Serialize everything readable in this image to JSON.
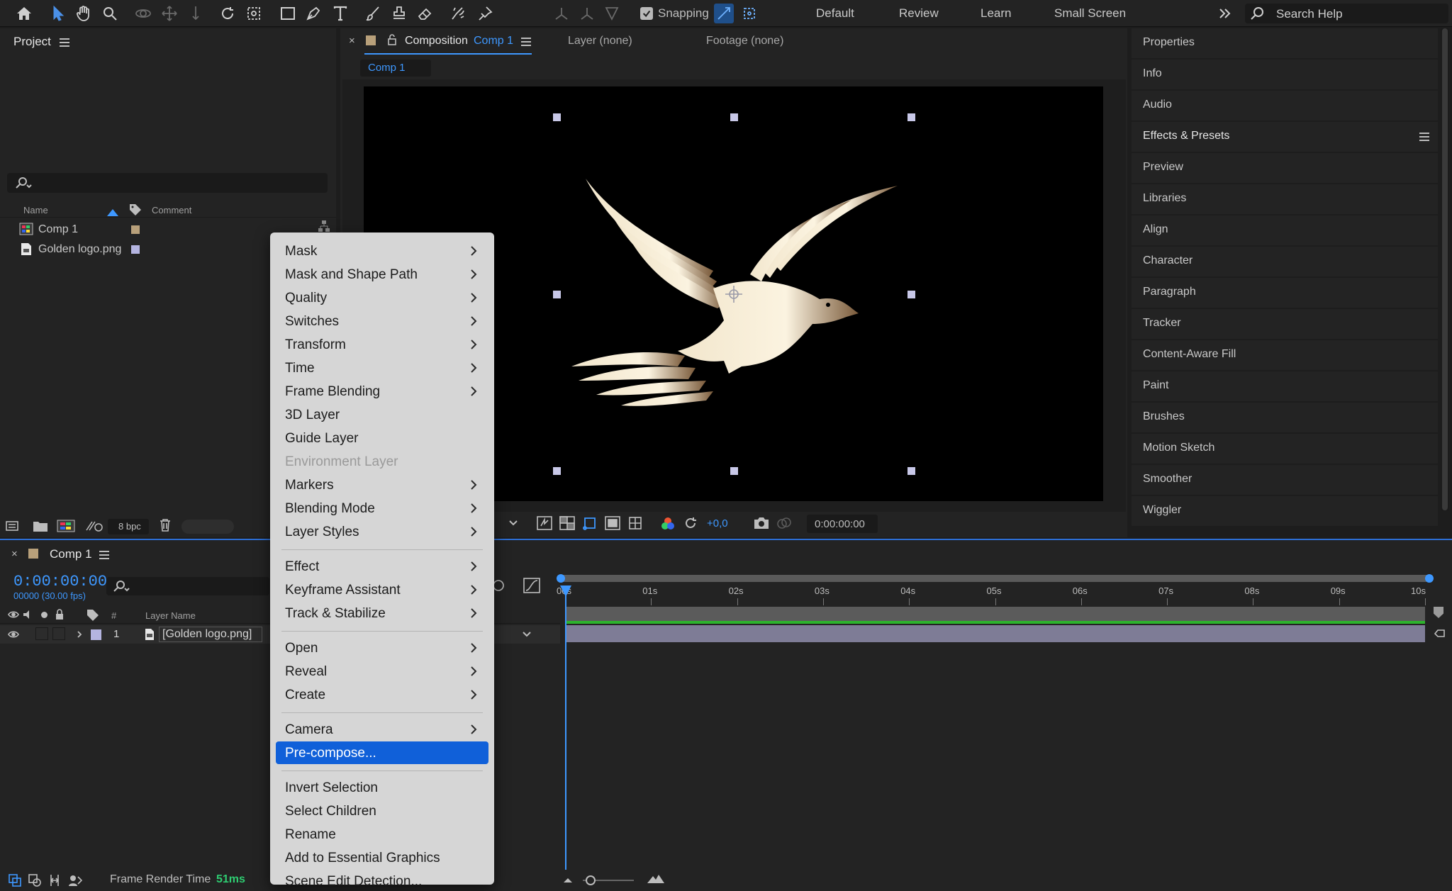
{
  "toolbar": {
    "snapping_label": "Snapping",
    "workspaces": [
      "Default",
      "Review",
      "Learn",
      "Small Screen"
    ],
    "search_placeholder": "Search Help"
  },
  "project": {
    "title": "Project",
    "columns": {
      "name": "Name",
      "comment": "Comment"
    },
    "items": [
      {
        "name": "Comp 1",
        "color": "#b8a07a",
        "icon": "composition-icon"
      },
      {
        "name": "Golden logo.png",
        "color": "#b4b4e0",
        "icon": "image-file-icon"
      }
    ],
    "bpc": "8 bpc"
  },
  "composition": {
    "tab_prefix": "Composition",
    "tab_comp": "Comp 1",
    "layer_tab": "Layer (none)",
    "footage_tab": "Footage (none)",
    "subtab": "Comp 1",
    "exposure": "+0,0",
    "timecode": "0:00:00:00"
  },
  "right_panels": [
    "Properties",
    "Info",
    "Audio",
    "Effects & Presets",
    "Preview",
    "Libraries",
    "Align",
    "Character",
    "Paragraph",
    "Tracker",
    "Content-Aware Fill",
    "Paint",
    "Brushes",
    "Motion Sketch",
    "Smoother",
    "Wiggler"
  ],
  "timeline": {
    "tab_title": "Comp 1",
    "timecode": "0:00:00:00",
    "fps": "00000 (30.00 fps)",
    "col_hash": "#",
    "col_layer_name": "Layer Name",
    "layer_index": "1",
    "layer_name": "[Golden logo.png]",
    "ruler": [
      "00s",
      "01s",
      "02s",
      "03s",
      "04s",
      "05s",
      "06s",
      "07s",
      "08s",
      "09s",
      "10s"
    ],
    "frame_render_label": "Frame Render Time",
    "frame_render_value": "51ms"
  },
  "context_menu": {
    "items": [
      {
        "label": "Mask",
        "submenu": true
      },
      {
        "label": "Mask and Shape Path",
        "submenu": true
      },
      {
        "label": "Quality",
        "submenu": true
      },
      {
        "label": "Switches",
        "submenu": true
      },
      {
        "label": "Transform",
        "submenu": true
      },
      {
        "label": "Time",
        "submenu": true
      },
      {
        "label": "Frame Blending",
        "submenu": true
      },
      {
        "label": "3D Layer",
        "submenu": false
      },
      {
        "label": "Guide Layer",
        "submenu": false
      },
      {
        "label": "Environment Layer",
        "submenu": false,
        "disabled": true
      },
      {
        "label": "Markers",
        "submenu": true
      },
      {
        "label": "Blending Mode",
        "submenu": true
      },
      {
        "label": "Layer Styles",
        "submenu": true
      },
      {
        "separator": true
      },
      {
        "label": "Effect",
        "submenu": true
      },
      {
        "label": "Keyframe Assistant",
        "submenu": true
      },
      {
        "label": "Track & Stabilize",
        "submenu": true
      },
      {
        "separator": true
      },
      {
        "label": "Open",
        "submenu": true
      },
      {
        "label": "Reveal",
        "submenu": true
      },
      {
        "label": "Create",
        "submenu": true
      },
      {
        "separator": true
      },
      {
        "label": "Camera",
        "submenu": true
      },
      {
        "label": "Pre-compose...",
        "submenu": false,
        "selected": true
      },
      {
        "separator": true
      },
      {
        "label": "Invert Selection",
        "submenu": false
      },
      {
        "label": "Select Children",
        "submenu": false
      },
      {
        "label": "Rename",
        "submenu": false
      },
      {
        "label": "Add to Essential Graphics",
        "submenu": false
      },
      {
        "label": "Scene Edit Detection...",
        "submenu": false
      }
    ]
  },
  "colors": {
    "accent": "#3e98ff",
    "selection": "#1060d9",
    "layer_bar": "#7e7c96",
    "track_green": "#2db32d"
  }
}
